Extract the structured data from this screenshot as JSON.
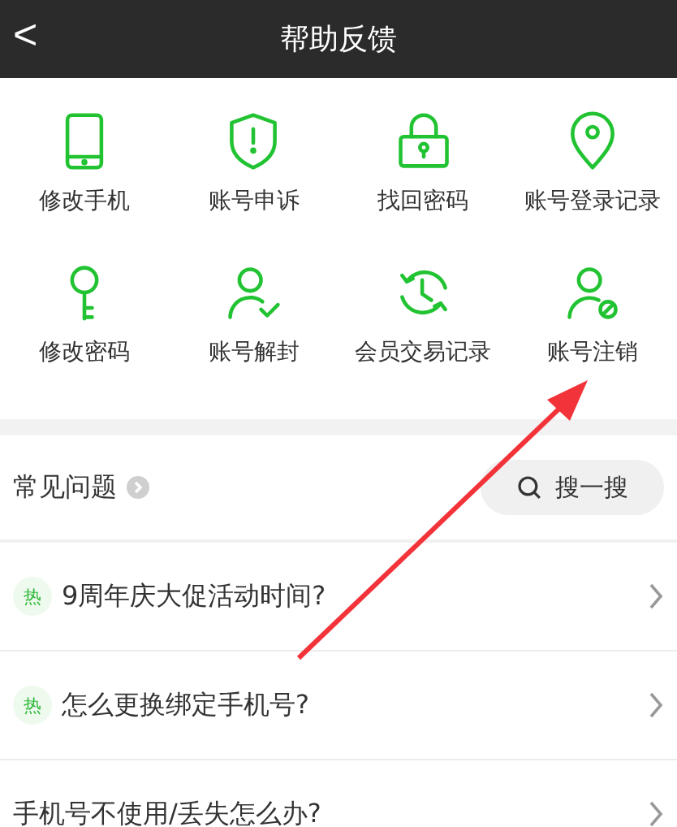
{
  "header": {
    "back": "<",
    "title": "帮助反馈"
  },
  "services": [
    {
      "kind": "phone",
      "label": "修改手机"
    },
    {
      "kind": "shield",
      "label": "账号申诉"
    },
    {
      "kind": "lock",
      "label": "找回密码"
    },
    {
      "kind": "pin",
      "label": "账号登录记录"
    },
    {
      "kind": "key",
      "label": "修改密码"
    },
    {
      "kind": "user-check",
      "label": "账号解封"
    },
    {
      "kind": "clock",
      "label": "会员交易记录"
    },
    {
      "kind": "user-ban",
      "label": "账号注销"
    }
  ],
  "faq": {
    "title": "常见问题",
    "search": "搜一搜",
    "items": [
      {
        "badge": "热",
        "text": "9周年庆大促活动时间?"
      },
      {
        "badge": "热",
        "text": "怎么更换绑定手机号?"
      },
      {
        "text": "手机号不使用/丢失怎么办?"
      }
    ]
  },
  "annotation": {
    "kind": "arrow"
  }
}
